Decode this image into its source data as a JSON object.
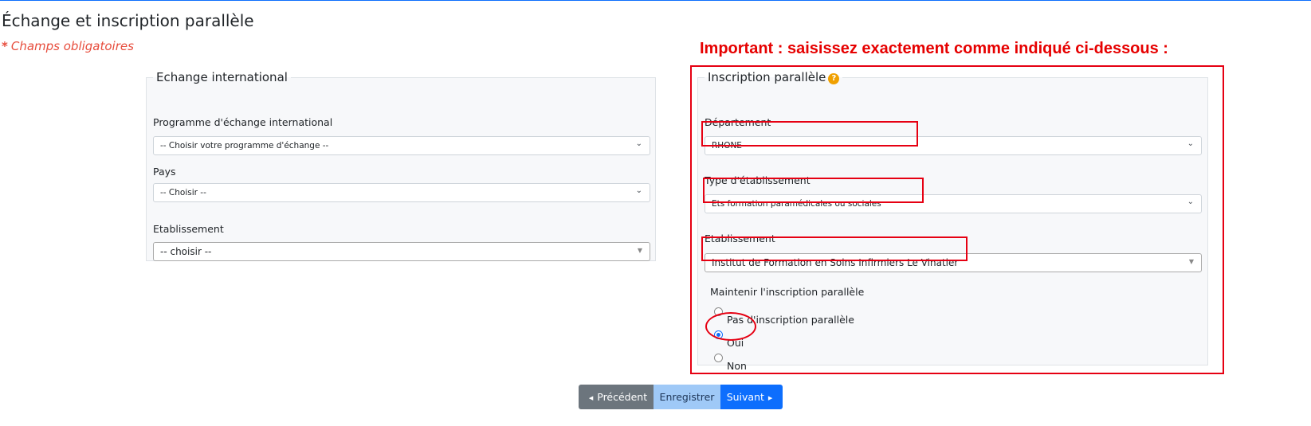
{
  "page": {
    "title": "Échange et inscription parallèle",
    "required_star": "*",
    "required_note": "Champs obligatoires",
    "important_note": "Important : saisissez exactement comme indiqué ci-dessous :"
  },
  "exchange": {
    "legend": "Echange international",
    "program_label": "Programme d'échange international",
    "program_value": "-- Choisir votre programme d'échange --",
    "country_label": "Pays",
    "country_value": "-- Choisir --",
    "institution_label": "Etablissement",
    "institution_value": "-- choisir --"
  },
  "parallel": {
    "legend": "Inscription parallèle",
    "help_icon": "?",
    "department_label": "Département",
    "department_value": "RHONE",
    "type_label": "Type d'établissement",
    "type_value": "Ets formation paramédicales ou sociales",
    "institution_label": "Etablissement",
    "institution_value": "Institut de Formation en Soins Infirmiers Le Vinatier",
    "maintain_label": "Maintenir l'inscription parallèle",
    "options": [
      {
        "label": "Pas d'inscription parallèle",
        "checked": false
      },
      {
        "label": "Oui",
        "checked": true
      },
      {
        "label": "Non",
        "checked": false
      }
    ]
  },
  "buttons": {
    "prev": "Précédent",
    "save": "Enregistrer",
    "next": "Suivant"
  },
  "icons": {
    "chevron": "chevron-down-icon",
    "prev": "caret-left-icon",
    "next": "caret-right-icon",
    "help": "question-circle-icon"
  },
  "colors": {
    "annotation_red": "#e60012",
    "primary": "#0d6efd",
    "secondary": "#6c757d",
    "help_orange": "#f0a000"
  }
}
